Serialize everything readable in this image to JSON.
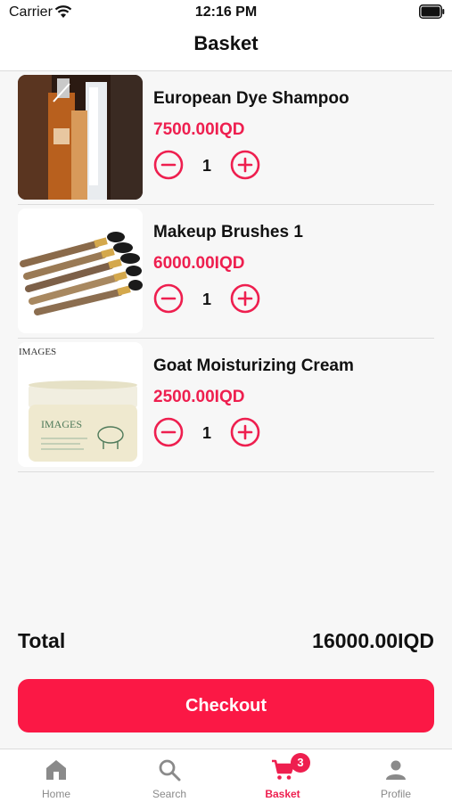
{
  "status_bar": {
    "carrier": "Carrier",
    "time": "12:16 PM"
  },
  "header": {
    "title": "Basket"
  },
  "basket": {
    "items": [
      {
        "name": "European Dye Shampoo",
        "price": "7500.00IQD",
        "quantity": "1"
      },
      {
        "name": "Makeup Brushes 1",
        "price": "6000.00IQD",
        "quantity": "1"
      },
      {
        "name": "Goat Moisturizing Cream",
        "price": "2500.00IQD",
        "quantity": "1"
      }
    ],
    "product_image_text": {
      "brand": "IMAGES"
    }
  },
  "summary": {
    "total_label": "Total",
    "total_value": "16000.00IQD"
  },
  "checkout_label": "Checkout",
  "tabbar": {
    "tabs": [
      {
        "label": "Home",
        "icon": "home-icon"
      },
      {
        "label": "Search",
        "icon": "search-icon"
      },
      {
        "label": "Basket",
        "icon": "cart-icon",
        "badge": "3"
      },
      {
        "label": "Profile",
        "icon": "profile-icon"
      }
    ],
    "active": "Basket"
  },
  "colors": {
    "accent": "#fb1845",
    "price": "#ee1f4f",
    "inactive_tab": "#8a8a8a"
  }
}
